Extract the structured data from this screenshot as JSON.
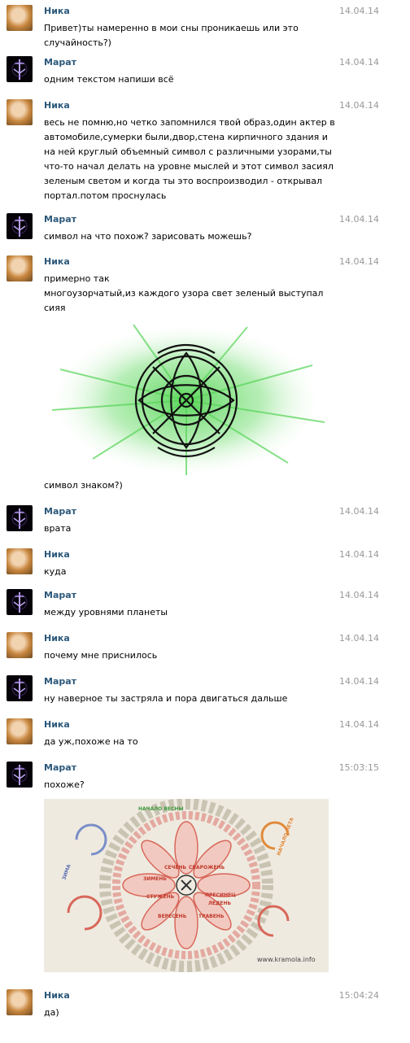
{
  "messages": [
    {
      "author": "Ника",
      "time": "14.04.14",
      "text": "Привет)ты намеренно в мои сны проникаешь или это\nслучайность?)"
    },
    {
      "author": "Марат",
      "time": "14.04.14",
      "text": "одним текстом напиши всё"
    },
    {
      "author": "Ника",
      "time": "14.04.14",
      "text": "весь не помню,но четко запомнился твой образ,один актер в\nавтомобиле,сумерки были,двор,стена кирпичного здания и\nна ней круглый объемный символ с различными узорами,ты\nчто-то начал делать на уровне мыслей и этот символ засиял\nзеленым светом и когда ты это воспроизводил - открывал\nпортал.потом проснулась"
    },
    {
      "author": "Марат",
      "time": "14.04.14",
      "text": "символ на что похож? зарисовать можешь?"
    },
    {
      "author": "Ника",
      "time": "14.04.14",
      "text": "примерно так\nмногоузорчатый,из каждого узора свет зеленый выступал\nсияя",
      "text_after": "символ знаком?)"
    },
    {
      "author": "Марат",
      "time": "14.04.14",
      "text": "врата"
    },
    {
      "author": "Ника",
      "time": "14.04.14",
      "text": "куда"
    },
    {
      "author": "Марат",
      "time": "14.04.14",
      "text": "между уровнями планеты"
    },
    {
      "author": "Ника",
      "time": "14.04.14",
      "text": "почему мне приснилось"
    },
    {
      "author": "Марат",
      "time": "14.04.14",
      "text": "ну наверное ты застряла и пора двигаться дальше"
    },
    {
      "author": "Ника",
      "time": "14.04.14",
      "text": "да уж,похоже на то"
    },
    {
      "author": "Марат",
      "time": "15:03:15",
      "text": "похоже?"
    },
    {
      "author": "Ника",
      "time": "15:04:24",
      "text": "да)"
    }
  ],
  "attachments": {
    "sketch_icon": "green-glowing-symbol-sketch",
    "calendar": {
      "watermark": "www.kramola.info",
      "ring_labels": [
        "СЕЧЕНЬ",
        "СВАРОЖЕНЬ",
        "ЛЕДЕНЬ",
        "СТУЖЕНЬ",
        "ВЕРЕСЕНЬ",
        "ТРАВЕНЬ",
        "ПРЕСИНЕЦ",
        "ЗИМЕНЬ"
      ],
      "corner_labels": [
        "НАЧАЛО ВЕСНЫ",
        "НАЧАЛО ЛЕТА",
        "ЗИМА"
      ]
    }
  },
  "colors": {
    "author": "#2b587a",
    "time": "#999999",
    "glow": "#5bd65b",
    "calendar_bg": "#efeae0"
  }
}
